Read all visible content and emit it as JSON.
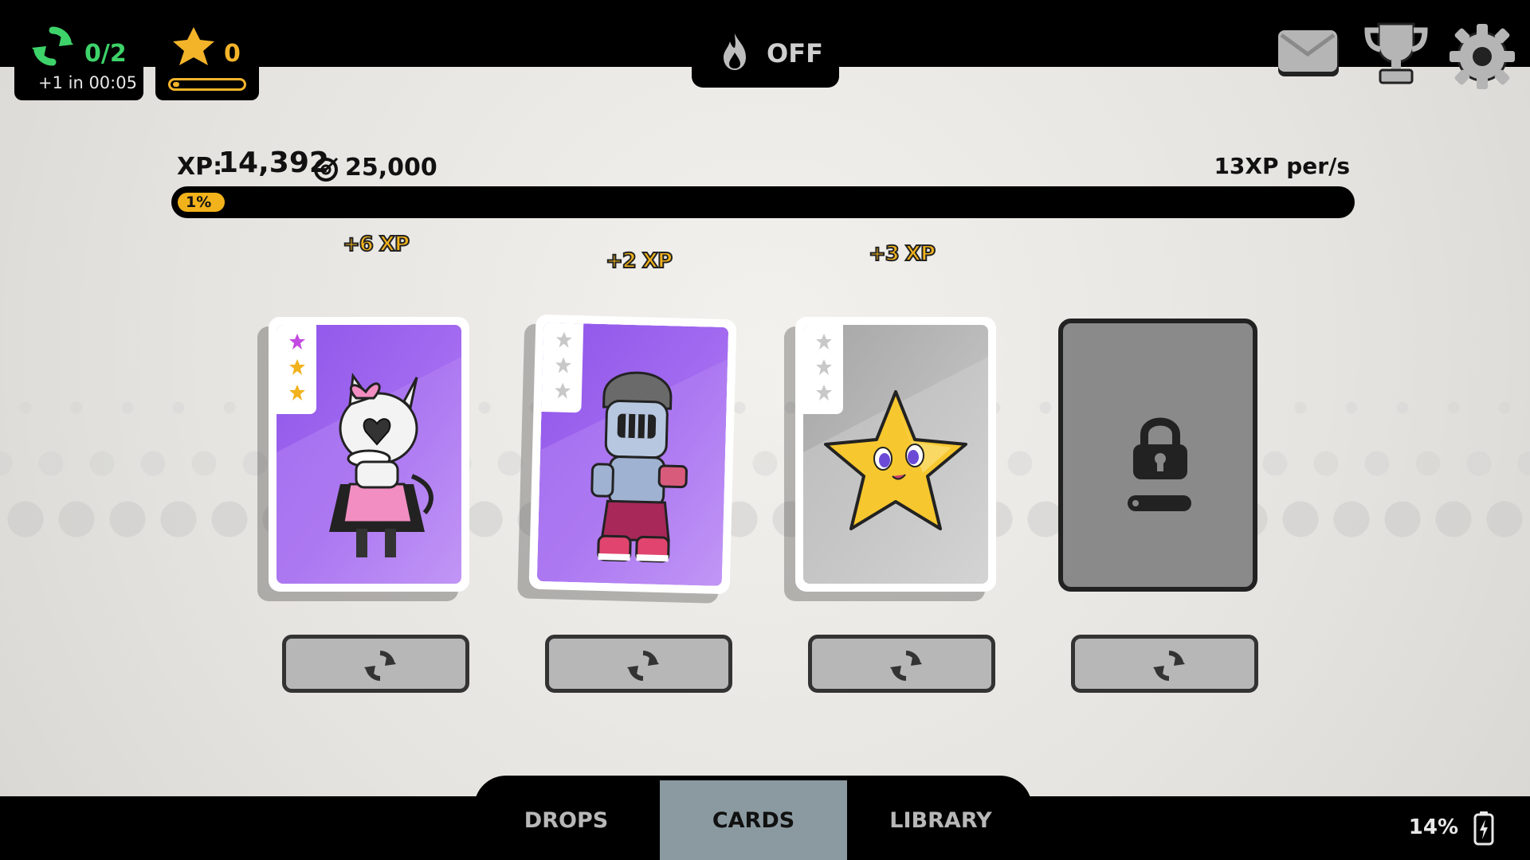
{
  "hud": {
    "refresh_count": "0/2",
    "refresh_timer": "+1 in 00:05",
    "star_count": "0",
    "star_progress_fraction": 0.05,
    "boost_status": "OFF"
  },
  "xp": {
    "label": "XP:",
    "value": "14,392",
    "goal": "25,000",
    "rate": "13XP per/s",
    "progress_label": "1%",
    "progress_percent": 1
  },
  "cards": [
    {
      "gain": "+6 XP",
      "art": "bunny-girl",
      "rarity_stars": [
        "purple",
        "gold",
        "gold"
      ]
    },
    {
      "gain": "+2 XP",
      "art": "knight",
      "rarity_stars": [
        "gray",
        "gray",
        "gray"
      ]
    },
    {
      "gain": "+3 XP",
      "art": "star",
      "rarity_stars": [
        "gray",
        "gray",
        "gray"
      ]
    },
    {
      "locked": true
    }
  ],
  "tabs": {
    "drops": "DROPS",
    "cards": "CARDS",
    "library": "LIBRARY",
    "active": "CARDS"
  },
  "status": {
    "battery": "14%"
  },
  "colors": {
    "accent_gold": "#f2b21b",
    "accent_green": "#3ed36a",
    "tab_active": "#8b9aa1"
  }
}
